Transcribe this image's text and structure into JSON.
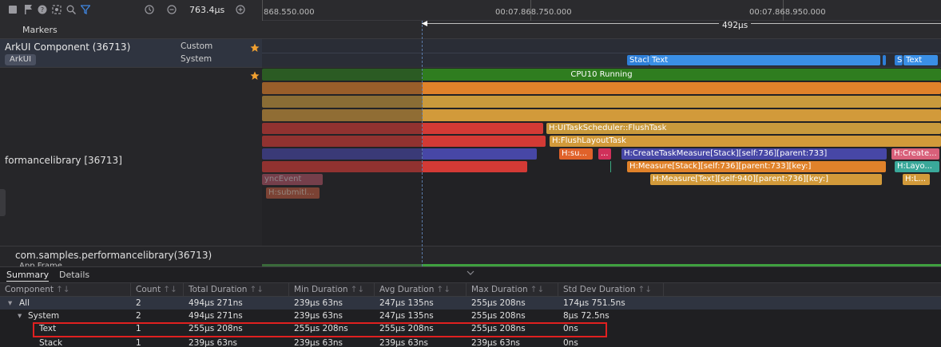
{
  "toolbar": {
    "icons": [
      "stop-icon",
      "flag-icon",
      "help-icon",
      "screenshot-icon",
      "search-icon",
      "filter-icon"
    ],
    "clock_icon": "clock-icon",
    "zoom_out_icon": "zoom-out-icon",
    "zoom_in_icon": "zoom-in-icon",
    "zoom_value": "763.4µs"
  },
  "ruler": {
    "tick_labels": [
      "868.550.000",
      "00:07.868.750.000",
      "00:07.868.950.000"
    ],
    "range_label": "492µs"
  },
  "tracks": {
    "markers_label": "Markers",
    "arkui": {
      "title": "ArkUI Component (36713)",
      "tag": "ArkUI",
      "sub1": "Custom",
      "sub2": "System",
      "bars": [
        "Stacl",
        "Text",
        "S",
        "Text"
      ]
    },
    "process": {
      "title": "formancelibrary [36713]",
      "cpu_label": "CPU10 Running",
      "slices": [
        "H:UITaskScheduler::FlushTask",
        "H:FlushLayoutTask",
        "H:su...",
        "...",
        "H:CreateTaskMeasure[Stack][self:736][parent:733]",
        "H:Create...",
        "H:Measure[Stack][self:736][parent:733][key:]",
        "H:Layo...",
        "H:Measure[Text][self:940][parent:736][key:]",
        "H:L...",
        "yncEvent",
        "H:submitl..."
      ]
    },
    "app": {
      "title": "com.samples.performancelibrary(36713)",
      "sub": "App Frame"
    }
  },
  "panel": {
    "tabs": [
      "Summary",
      "Details"
    ],
    "columns": [
      "Component",
      "Count",
      "Total Duration",
      "Min Duration",
      "Avg Duration",
      "Max Duration",
      "Std Dev Duration"
    ],
    "rows": [
      {
        "name": "All",
        "count": "2",
        "total": "494µs 271ns",
        "min": "239µs 63ns",
        "avg": "247µs 135ns",
        "max": "255µs 208ns",
        "std": "174µs 751.5ns"
      },
      {
        "name": "System",
        "count": "2",
        "total": "494µs 271ns",
        "min": "239µs 63ns",
        "avg": "247µs 135ns",
        "max": "255µs 208ns",
        "std": "8µs 72.5ns"
      },
      {
        "name": "Text",
        "count": "1",
        "total": "255µs 208ns",
        "min": "255µs 208ns",
        "avg": "255µs 208ns",
        "max": "255µs 208ns",
        "std": "0ns"
      },
      {
        "name": "Stack",
        "count": "1",
        "total": "239µs 63ns",
        "min": "239µs 63ns",
        "avg": "239µs 63ns",
        "max": "239µs 63ns",
        "std": "0ns"
      }
    ]
  },
  "colors": {
    "cpu_green": "#2f7d1f",
    "slice_orange": "#e0822a",
    "slice_gold": "#c99a3c",
    "slice_red": "#d33a35",
    "slice_blue": "#4747a6",
    "arkui_blue": "#2e7fd8",
    "highlight_red": "#e02020",
    "star": "#f0a030"
  }
}
